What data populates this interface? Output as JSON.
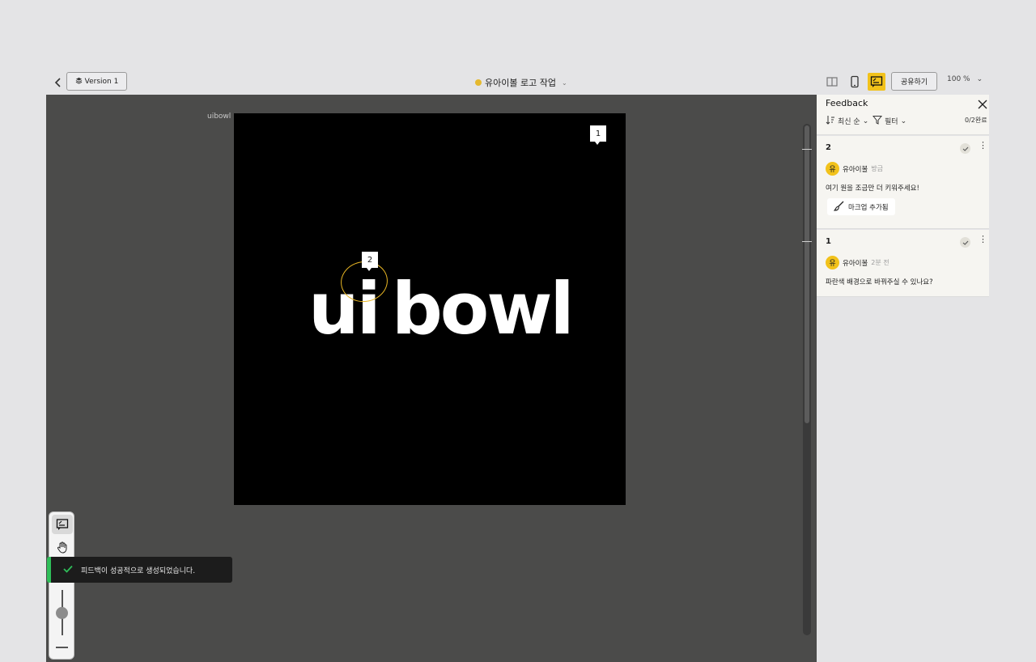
{
  "header": {
    "version_label": "Version 1",
    "project_title": "유아이볼 로고 작업",
    "share_label": "공유하기",
    "zoom_label": "100 %",
    "accent_color": "#f2c21b",
    "status_dot_color": "#e5b92f",
    "icons": [
      "back-arrow-icon",
      "layers-icon",
      "split-view-icon",
      "mobile-icon",
      "feedback-icon",
      "chevron-down-icon"
    ]
  },
  "canvas": {
    "frame_label": "uibowl",
    "logo_text_ui": "ui",
    "logo_text_bowl": "bowl",
    "pins": [
      {
        "number": "1"
      },
      {
        "number": "2"
      }
    ]
  },
  "tools": {
    "items": [
      "comment-tool-icon",
      "hand-tool-icon"
    ]
  },
  "toast": {
    "message": "피드백이 성공적으로 생성되었습니다.",
    "color": "#2fbe59"
  },
  "feedback_panel": {
    "title": "Feedback",
    "sort_label": "최신 순",
    "filter_label": "필터",
    "done_count": "0/2완료",
    "comments": [
      {
        "number": "2",
        "avatar_char": "유",
        "author": "유아이볼",
        "time": "방금",
        "text": "여기 원을 조금만 더 키워주세요!",
        "markup_label": "마크업 추가됨"
      },
      {
        "number": "1",
        "avatar_char": "유",
        "author": "유아이볼",
        "time": "2분 전",
        "text": "파란색 배경으로 바꿔주실 수 있나요?"
      }
    ]
  }
}
